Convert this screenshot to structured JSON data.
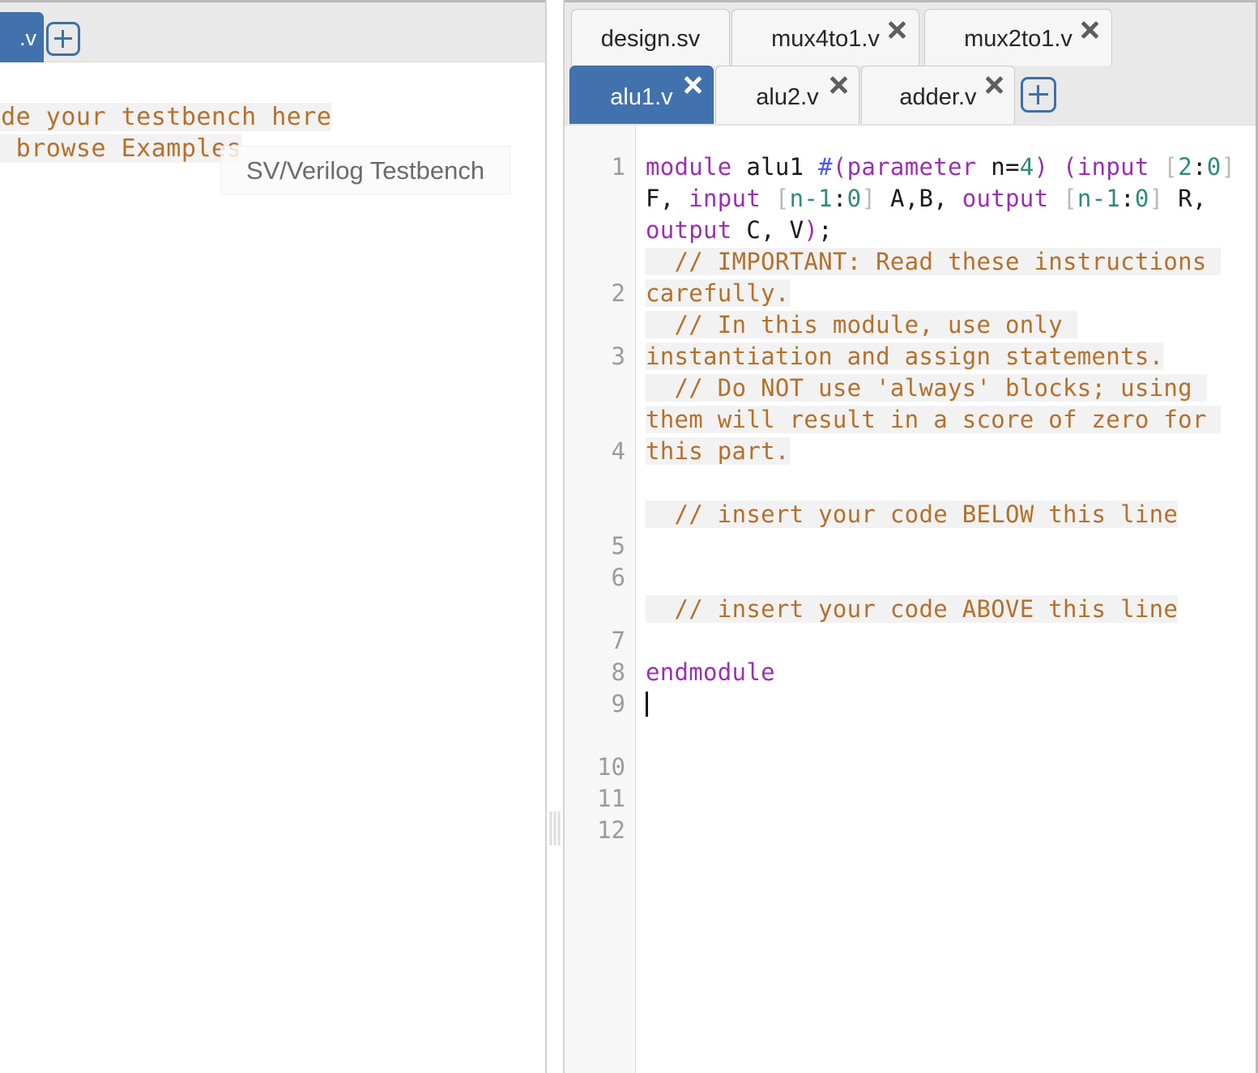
{
  "left_panel": {
    "tab": {
      "label": ".v",
      "name": "testbench-tab"
    },
    "add_tab_label": "+",
    "placeholder_line1": "Code your testbench here",
    "placeholder_line2": "or browse Examples",
    "tooltip": "SV/Verilog Testbench"
  },
  "right_panel": {
    "add_tab_label": "+",
    "tabs_row1": [
      {
        "label": "design.sv",
        "closable": false,
        "active": false
      },
      {
        "label": "mux4to1.v",
        "closable": true,
        "active": false
      },
      {
        "label": "mux2to1.v",
        "closable": true,
        "active": false
      }
    ],
    "tabs_row2": [
      {
        "label": "alu1.v",
        "closable": true,
        "active": true
      },
      {
        "label": "alu2.v",
        "closable": true,
        "active": false
      },
      {
        "label": "adder.v",
        "closable": true,
        "active": false
      }
    ]
  },
  "editor": {
    "active_file": "alu1.v",
    "cursor_line": 12,
    "line_numbers": [
      1,
      2,
      3,
      4,
      5,
      6,
      7,
      8,
      9,
      10,
      11,
      12
    ],
    "lines": [
      {
        "n": 1,
        "text": "module alu1 #(parameter n=4) (input [2:0] F, input [n-1:0] A,B, output [n-1:0] R, output C, V);"
      },
      {
        "n": 2,
        "text": "  // IMPORTANT: Read these instructions carefully."
      },
      {
        "n": 3,
        "text": "  // In this module, use only instantiation and assign statements."
      },
      {
        "n": 4,
        "text": "  // Do NOT use 'always' blocks; using them will result in a score of zero for this part."
      },
      {
        "n": 5,
        "text": ""
      },
      {
        "n": 6,
        "text": "  // insert your code BELOW this line"
      },
      {
        "n": 7,
        "text": ""
      },
      {
        "n": 8,
        "text": ""
      },
      {
        "n": 9,
        "text": "  // insert your code ABOVE this line"
      },
      {
        "n": 10,
        "text": ""
      },
      {
        "n": 11,
        "text": "endmodule"
      },
      {
        "n": 12,
        "text": ""
      }
    ],
    "tokens": {
      "l1_kw_module": "module",
      "l1_name": " alu1 ",
      "l1_hash": "#",
      "l1_kw_param": "(parameter",
      "l1_n": " n=",
      "l1_4": "4",
      "l1_paren1": ")",
      "l1_paren2": "(",
      "l1_kw_input1": "input",
      "l1_br1": " [",
      "l1_2": "2",
      "l1_colon1": ":",
      "l1_0a": "0",
      "l1_br2": "]",
      "l1_F": " F, ",
      "l1_kw_input2": "input",
      "l1_br3": " [",
      "l1_n1": "n-1",
      "l1_colon2": ":",
      "l1_0b": "0",
      "l1_br4": "]",
      "l1_AB": " A,B, ",
      "l1_kw_output1": "output",
      "l1_br5": " [",
      "l1_n2": "n-1",
      "l1_colon3": ":",
      "l1_0c": "0",
      "l1_br6": "]",
      "l1_R": " R, ",
      "l1_kw_output2": "output",
      "l1_CV": " C, V",
      "l1_close": ")",
      "l1_semi": ";",
      "l2": "  // IMPORTANT: Read these instructions carefully.",
      "l3": "  // In this module, use only instantiation and assign statements.",
      "l4": "  // Do NOT use 'always' blocks; using them will result in a score of zero for this part.",
      "l6": "  // insert your code BELOW this line",
      "l9": "  // insert your code ABOVE this line",
      "l11_kw": "endmodule"
    }
  },
  "colors": {
    "active_tab_blue": "#4272ad",
    "keyword_purple": "#9b30b0",
    "comment_brown": "#b5702b",
    "number_teal": "#2e8b7a",
    "hash_blue": "#4a5ae8",
    "tabbar_gray": "#e9e9e9",
    "gutter_gray": "#f7f7f7"
  }
}
